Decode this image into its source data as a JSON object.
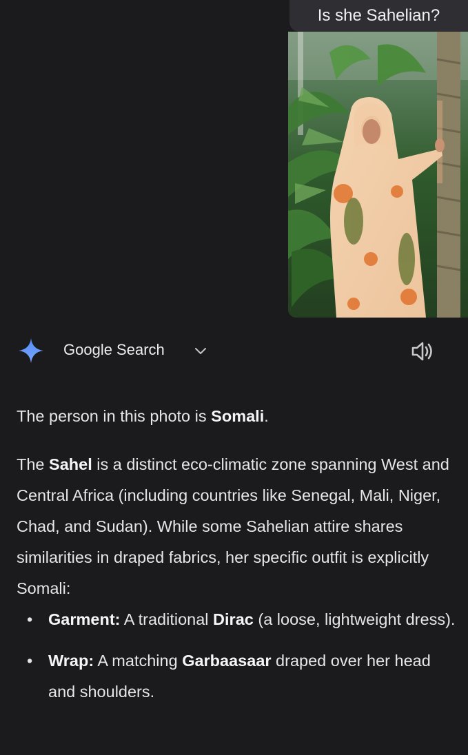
{
  "user_message": {
    "text": "Is she Sahelian?",
    "image_alt": "Photo of a woman in a peach patterned dress and head wrap standing beside a palm tree in a greenhouse"
  },
  "response_header": {
    "source_label": "Google Search",
    "icons": [
      "gemini-spark-icon",
      "chevron-down-icon",
      "speaker-icon"
    ],
    "colors": {
      "spark_top": "#4f8df5",
      "spark_bottom": "#7ea7ff"
    }
  },
  "answer": {
    "p1": {
      "a": "The person in this photo is ",
      "b": "Somali",
      "c": "."
    },
    "p2": {
      "a": "The ",
      "b": "Sahel",
      "c": " is a distinct eco-climatic zone spanning West and Central Africa (including countries like Senegal, Mali, Niger, Chad, and Sudan). While some Sahelian attire shares similarities in draped fabrics, her specific outfit is explicitly Somali:"
    },
    "bullets": [
      {
        "label": "Garment:",
        "a": " A traditional ",
        "b": "Dirac",
        "c": " (a loose, lightweight dress)."
      },
      {
        "label": "Wrap:",
        "a": " A matching ",
        "b": "Garbaasaar",
        "c": " draped over her head and shoulders."
      }
    ],
    "bullet_char": "•"
  }
}
